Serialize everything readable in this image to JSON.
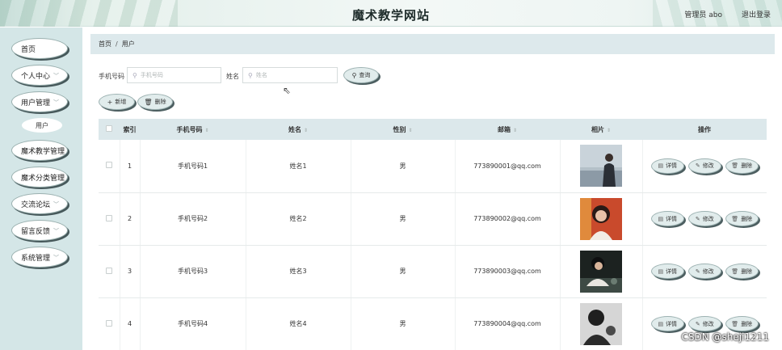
{
  "header": {
    "title": "魔术教学网站",
    "user_info": "管理员 abo",
    "logout_label": "退出登录"
  },
  "sidebar": {
    "items": [
      {
        "label": "首页",
        "chevron": false
      },
      {
        "label": "个人中心",
        "chevron": true
      },
      {
        "label": "用户管理",
        "chevron": true
      },
      {
        "label": "魔术教学管理",
        "chevron": false
      },
      {
        "label": "魔术分类管理",
        "chevron": false
      },
      {
        "label": "交流论坛",
        "chevron": true
      },
      {
        "label": "留言反馈",
        "chevron": true
      },
      {
        "label": "系统管理",
        "chevron": true
      }
    ],
    "sub_item": "用户"
  },
  "breadcrumb": {
    "home": "首页",
    "separator": "/",
    "current": "用户"
  },
  "search": {
    "phone_label": "手机号码",
    "phone_placeholder": "手机号码",
    "name_label": "姓名",
    "name_placeholder": "姓名",
    "query_button": "查询"
  },
  "actions": {
    "add_button": "新增",
    "delete_button": "删除"
  },
  "table": {
    "columns": [
      "索引",
      "手机号码",
      "姓名",
      "性别",
      "邮箱",
      "相片",
      "操作"
    ],
    "rows": [
      {
        "index": "1",
        "phone": "手机号码1",
        "name": "姓名1",
        "gender": "男",
        "email": "773890001@qq.com"
      },
      {
        "index": "2",
        "phone": "手机号码2",
        "name": "姓名2",
        "gender": "男",
        "email": "773890002@qq.com"
      },
      {
        "index": "3",
        "phone": "手机号码3",
        "name": "姓名3",
        "gender": "男",
        "email": "773890003@qq.com"
      },
      {
        "index": "4",
        "phone": "手机号码4",
        "name": "姓名4",
        "gender": "男",
        "email": "773890004@qq.com"
      }
    ],
    "row_actions": {
      "detail": "详情",
      "edit": "修改",
      "delete": "删除"
    }
  },
  "watermark": "CSDN @sheji1211",
  "colors": {
    "sidebar_bg": "#d4e6e7",
    "header_bg": "#eaf3f0",
    "table_header_bg": "#dce8eb",
    "button_bg": "#e1ecec"
  }
}
